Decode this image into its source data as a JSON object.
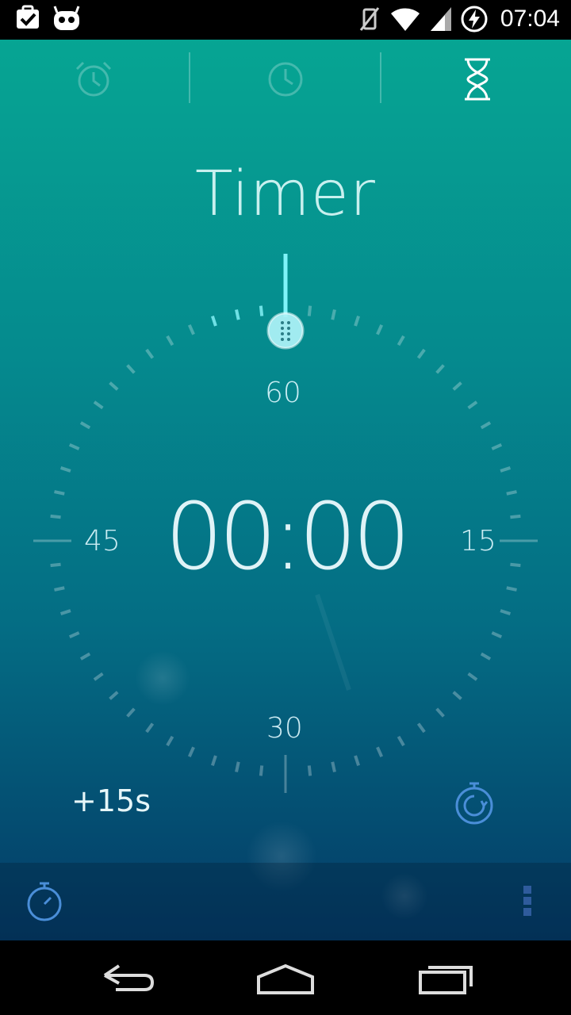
{
  "status_bar": {
    "time": "07:04",
    "icons": [
      "task-check-icon",
      "cyanogen-mascot-icon",
      "vibrate-off-icon",
      "wifi-icon",
      "signal-icon",
      "battery-charging-icon"
    ]
  },
  "tabs": [
    {
      "name": "alarm",
      "icon": "alarm-clock-icon",
      "selected": false
    },
    {
      "name": "clock",
      "icon": "clock-icon",
      "selected": false
    },
    {
      "name": "timer",
      "icon": "hourglass-icon",
      "selected": true
    }
  ],
  "title": "Timer",
  "dial": {
    "label_60": "60",
    "label_15": "15",
    "label_30": "30",
    "label_45": "45"
  },
  "timer": {
    "display": "00:00"
  },
  "actions": {
    "add_time_label": "+15s",
    "reset_icon": "stopwatch-reset-icon"
  },
  "bottom_bar": {
    "left_icon": "stopwatch-icon",
    "right_icon": "overflow-menu-icon"
  },
  "nav_bar": {
    "buttons": [
      "back-icon",
      "home-icon",
      "recents-icon"
    ]
  },
  "colors": {
    "accent": "#5fe3f0",
    "muted_blue": "#4a8ed8",
    "background_top": "#06a593",
    "background_bottom": "#043a66"
  }
}
